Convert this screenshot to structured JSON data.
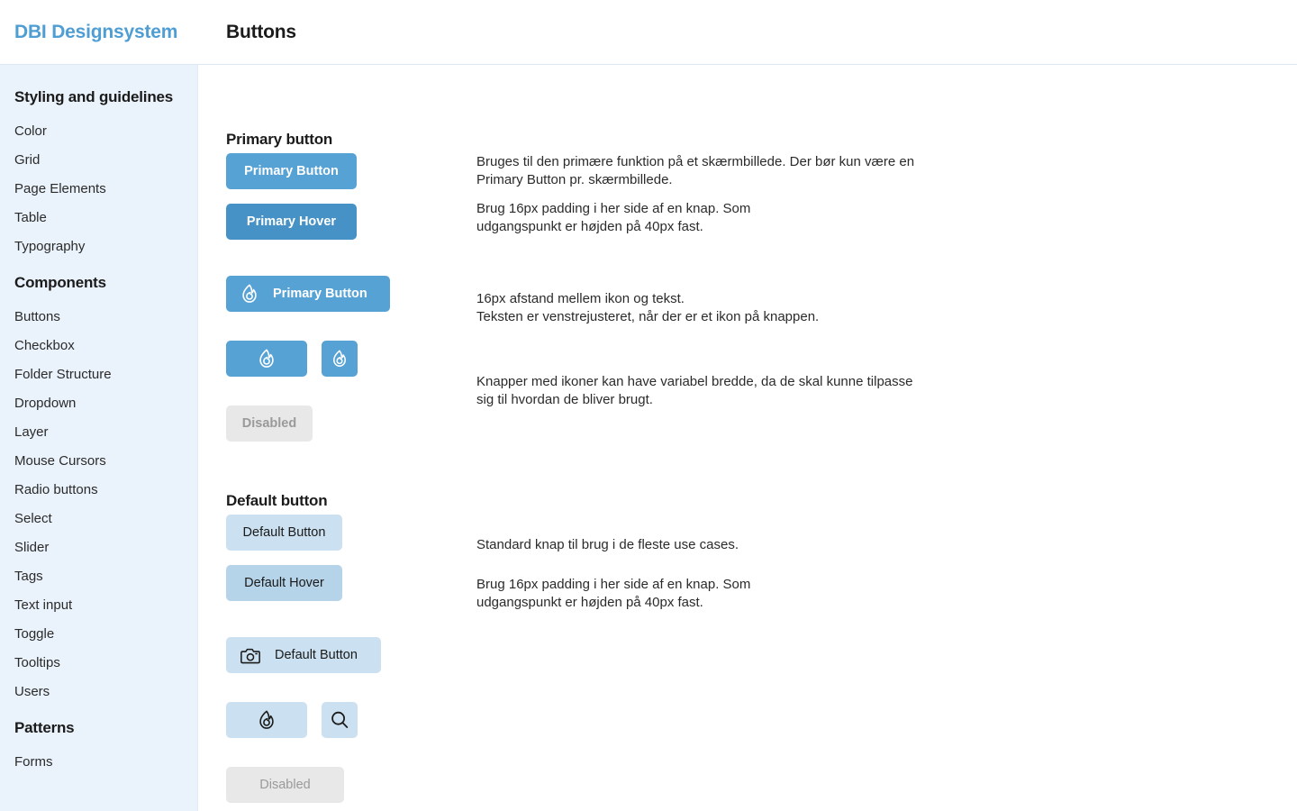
{
  "header": {
    "brand": "DBI Designsystem",
    "title": "Buttons"
  },
  "sidebar": {
    "groups": [
      {
        "title": "Styling and guidelines",
        "items": [
          {
            "label": "Color"
          },
          {
            "label": "Grid"
          },
          {
            "label": "Page Elements"
          },
          {
            "label": "Table"
          },
          {
            "label": "Typography"
          }
        ]
      },
      {
        "title": "Components",
        "items": [
          {
            "label": "Buttons"
          },
          {
            "label": "Checkbox"
          },
          {
            "label": "Folder Structure"
          },
          {
            "label": "Dropdown"
          },
          {
            "label": "Layer"
          },
          {
            "label": "Mouse Cursors"
          },
          {
            "label": "Radio buttons"
          },
          {
            "label": "Select"
          },
          {
            "label": "Slider"
          },
          {
            "label": "Tags"
          },
          {
            "label": "Text input"
          },
          {
            "label": "Toggle"
          },
          {
            "label": "Tooltips"
          },
          {
            "label": "Users"
          }
        ]
      },
      {
        "title": "Patterns",
        "items": [
          {
            "label": "Forms"
          }
        ]
      }
    ]
  },
  "sections": {
    "primary": {
      "title": "Primary button",
      "buttons": {
        "primary": "Primary Button",
        "primary_hover": "Primary Hover",
        "primary_icon": "Primary Button",
        "disabled": "Disabled"
      },
      "icons": {
        "flame": "flame-icon"
      },
      "descriptions": {
        "d1_line1": "Bruges til den primære funktion på et skærmbillede. Der bør kun være en",
        "d1_line2": "Primary Button pr. skærmbillede.",
        "d2_line1": "Brug 16px padding i her side af en knap. Som",
        "d2_line2": "udgangspunkt er højden på 40px fast.",
        "d3_line1": "16px afstand mellem ikon og tekst.",
        "d3_line2": "Teksten er venstrejusteret, når der er et ikon på knappen.",
        "d4_line1": "Knapper med ikoner kan have variabel bredde, da de skal kunne tilpasse",
        "d4_line2": "sig til hvordan de bliver brugt."
      }
    },
    "default": {
      "title": "Default button",
      "buttons": {
        "default": "Default Button",
        "default_hover": "Default Hover",
        "default_icon": "Default Button",
        "disabled": "Disabled"
      },
      "icons": {
        "camera": "camera-icon",
        "flame": "flame-icon",
        "search": "search-icon"
      },
      "descriptions": {
        "d1": "Standard knap til brug i de fleste use cases.",
        "d2_line1": "Brug 16px padding i her side af en knap. Som",
        "d2_line2": "udgangspunkt er højden på 40px fast."
      }
    }
  },
  "colors": {
    "brand": "#4e9ed4",
    "primary": "#57a2d4",
    "primary_hover": "#4692c6",
    "default": "#cbe0f0",
    "default_hover": "#b6d4e9",
    "disabled_bg": "#e8e8e8",
    "disabled_text": "#9a9a9a",
    "sidebar_bg": "#eaf2fb",
    "text": "#1b1b1b"
  }
}
